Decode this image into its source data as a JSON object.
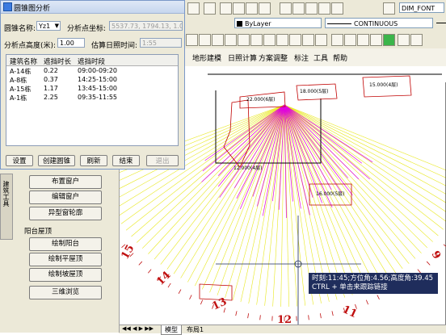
{
  "dialog": {
    "title": "圆锥图分析",
    "cone_name_label": "圆锥名称:",
    "cone_name_value": "Yz1",
    "analysis_coord_label": "分析点坐标:",
    "analysis_coord_value": "5537.73, 1794.13, 1.00",
    "analysis_height_label": "分析点高度(米):",
    "analysis_height_value": "1.00",
    "est_sunshine_label": "估算日照时间:",
    "est_sunshine_value": "1:55",
    "table_headers": [
      "建筑名称",
      "遮挡时长",
      "遮挡时段"
    ],
    "table_rows": [
      [
        "A-14栋",
        "0.22",
        "09:00-09:20"
      ],
      [
        "A-8栋",
        "0.37",
        "14:25-15:00"
      ],
      [
        "A-15栋",
        "1.17",
        "13:45-15:00"
      ],
      [
        "A-1栋",
        "2.25",
        "09:35-11:55"
      ]
    ],
    "buttons": [
      "设置",
      "创建圆锥",
      "刷新",
      "结束",
      "退出"
    ]
  },
  "toolbar": {
    "layer_dropdown": "ByLayer",
    "linetype_dropdown": "CONTINUOUS",
    "dim_dropdown": "DIM_FONT"
  },
  "menubar": {
    "items": [
      "地形建模",
      "日照计算",
      "方案调整",
      "标注",
      "工具",
      "帮助"
    ]
  },
  "side_panel": {
    "tab_label": "建筑工具",
    "buttons_top": [
      "布置窗户",
      "编辑窗户",
      "异型窗轮廓"
    ],
    "section_label": "阳台屋顶",
    "buttons_bottom": [
      "绘制阳台",
      "绘制平屋顶",
      "绘制坡屋顶",
      "三维浏览"
    ]
  },
  "drawing": {
    "clock_labels": [
      "15",
      "14",
      "13",
      "12",
      "11",
      "10",
      "9"
    ],
    "building_labels": [
      "A-14栋",
      "A-8栋",
      "A-15栋",
      "A-1栋"
    ],
    "height_labels": [
      "22.000(6层)",
      "18.000(5层)",
      "15.000(4层)",
      "12.000(4层)",
      "16.000(5层)"
    ]
  },
  "tooltip": {
    "line1": "时刻:11:45;方位角:4.56;高度角:39.45",
    "line2": "CTRL + 单击来跟踪链接"
  },
  "bottom_tabs": [
    "模型",
    "布局1"
  ],
  "colors": {
    "cone_magenta": "#e000e0",
    "shadow_yellow": "#e8e820",
    "clock_red": "#c01010",
    "tooltip_bg": "#1f2d5c"
  }
}
